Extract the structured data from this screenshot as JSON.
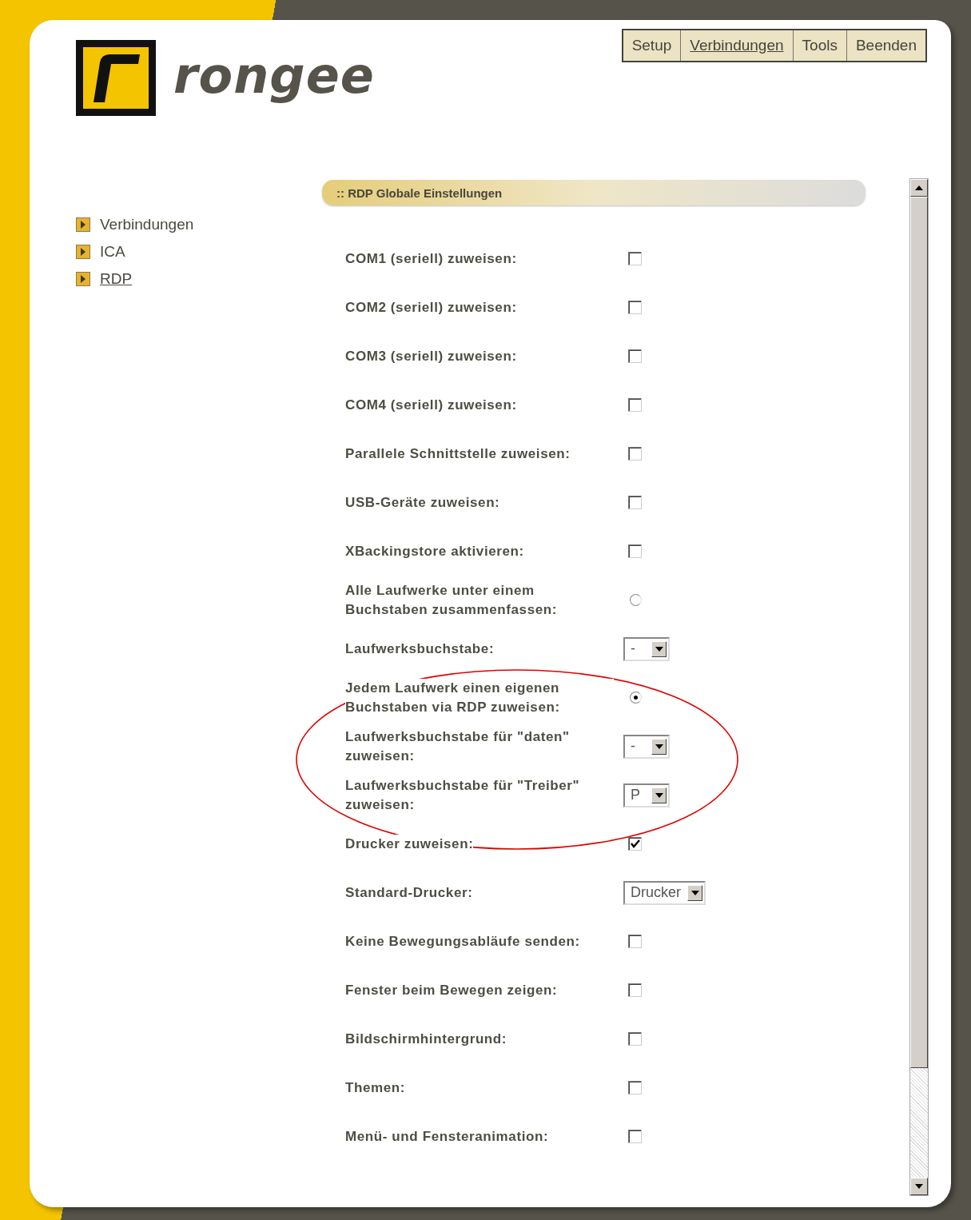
{
  "logo": {
    "wordmark": "rongee"
  },
  "nav": [
    {
      "label": "Setup",
      "selected": false
    },
    {
      "label": "Verbindungen",
      "selected": true
    },
    {
      "label": "Tools",
      "selected": false
    },
    {
      "label": "Beenden",
      "selected": false
    }
  ],
  "sidebar": {
    "items": [
      {
        "label": "Verbindungen",
        "selected": false
      },
      {
        "label": "ICA",
        "selected": false
      },
      {
        "label": "RDP",
        "selected": true
      }
    ]
  },
  "section": {
    "title": ":: RDP Globale Einstellungen"
  },
  "settings": [
    {
      "kind": "checkbox",
      "label": "COM1 (seriell) zuweisen:",
      "checked": false
    },
    {
      "kind": "checkbox",
      "label": "COM2 (seriell) zuweisen:",
      "checked": false
    },
    {
      "kind": "checkbox",
      "label": "COM3 (seriell) zuweisen:",
      "checked": false
    },
    {
      "kind": "checkbox",
      "label": "COM4 (seriell) zuweisen:",
      "checked": false
    },
    {
      "kind": "checkbox",
      "label": "Parallele Schnittstelle zuweisen:",
      "checked": false
    },
    {
      "kind": "checkbox",
      "label": "USB-Geräte zuweisen:",
      "checked": false
    },
    {
      "kind": "checkbox",
      "label": "XBackingstore aktivieren:",
      "checked": false
    },
    {
      "kind": "radio",
      "label": "Alle Laufwerke unter einem Buchstaben zusammenfassen:",
      "selected": false
    },
    {
      "kind": "select",
      "label": "Laufwerksbuchstabe:",
      "value": "-"
    },
    {
      "kind": "radio",
      "label": "Jedem Laufwerk einen eigenen Buchstaben via RDP zuweisen:",
      "selected": true
    },
    {
      "kind": "select",
      "label": "Laufwerksbuchstabe für \"daten\" zuweisen:",
      "value": "-"
    },
    {
      "kind": "select",
      "label": "Laufwerksbuchstabe für \"Treiber\" zuweisen:",
      "value": "P"
    },
    {
      "kind": "checkbox",
      "label": "Drucker zuweisen:",
      "checked": true
    },
    {
      "kind": "select",
      "label": "Standard-Drucker:",
      "value": "Drucker"
    },
    {
      "kind": "checkbox",
      "label": "Keine Bewegungsabläufe senden:",
      "checked": false
    },
    {
      "kind": "checkbox",
      "label": "Fenster beim Bewegen zeigen:",
      "checked": false
    },
    {
      "kind": "checkbox",
      "label": "Bildschirmhintergrund:",
      "checked": false
    },
    {
      "kind": "checkbox",
      "label": "Themen:",
      "checked": false
    },
    {
      "kind": "checkbox",
      "label": "Menü- und Fensteranimation:",
      "checked": false
    }
  ]
}
